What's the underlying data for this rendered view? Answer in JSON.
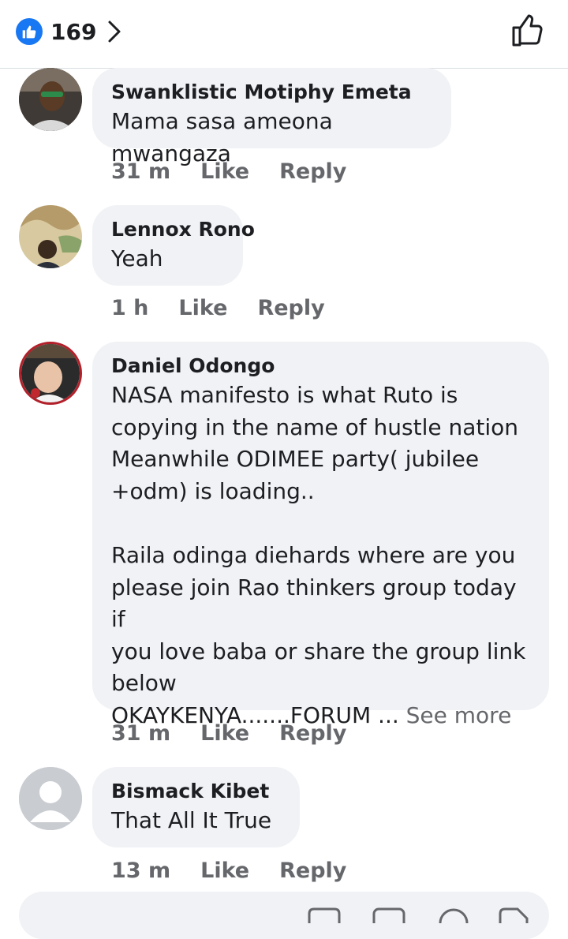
{
  "header": {
    "like_count": "169",
    "like_icon": "thumbs-up-icon",
    "chevron_icon": "chevron-right-icon",
    "like_button_icon": "thumbs-up-outline-icon"
  },
  "comments": [
    {
      "author": "Swanklistic Motiphy Emeta",
      "text": "Mama sasa ameona mwangaza",
      "time": "31 m",
      "like_label": "Like",
      "reply_label": "Reply"
    },
    {
      "author": "Lennox Rono",
      "text": "Yeah",
      "time": "1 h",
      "like_label": "Like",
      "reply_label": "Reply"
    },
    {
      "author": "Daniel Odongo",
      "text": "NASA manifesto is what Ruto is\ncopying in the name of hustle nation\nMeanwhile ODIMEE party( jubilee\n+odm) is loading..\n\nRaila odinga diehards where are you\nplease join Rao thinkers group today if\nyou love baba or share the group link\nbelow\nOKAYKENYA.......FORUM ... ",
      "see_more": "See more",
      "time": "31 m",
      "like_label": "Like",
      "reply_label": "Reply"
    },
    {
      "author": "Bismack Kibet",
      "text": "That All It True",
      "time": "13 m",
      "like_label": "Like",
      "reply_label": "Reply"
    }
  ],
  "colors": {
    "accent": "#1877f2",
    "bubble": "#f0f2f5",
    "meta_text": "#65676b"
  }
}
